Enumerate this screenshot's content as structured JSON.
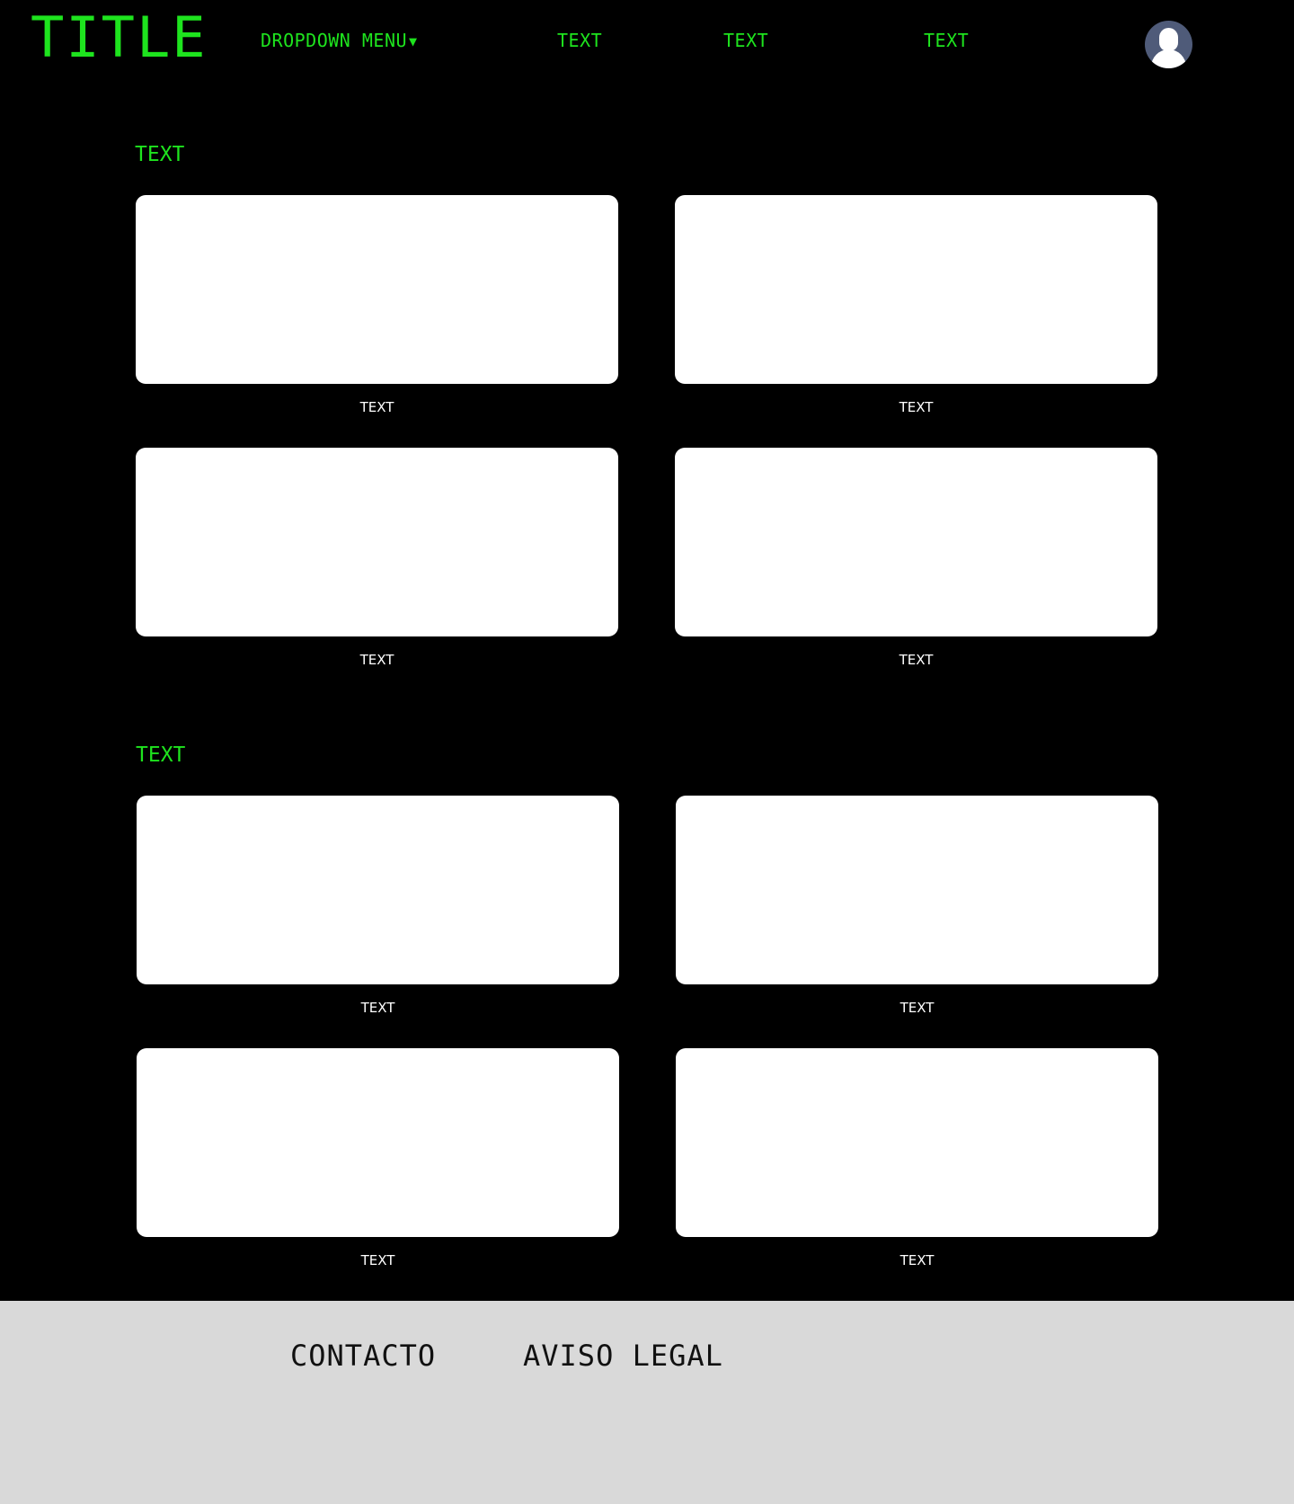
{
  "header": {
    "title": "TITLE",
    "nav": {
      "dropdown_label": "DROPDOWN MENU",
      "dropdown_caret": "▼",
      "items": [
        "TEXT",
        "TEXT",
        "TEXT"
      ]
    },
    "avatar_icon": "user-avatar-icon"
  },
  "sections": [
    {
      "title": "TEXT",
      "cards": [
        {
          "label": "TEXT"
        },
        {
          "label": "TEXT"
        },
        {
          "label": "TEXT"
        },
        {
          "label": "TEXT"
        }
      ]
    },
    {
      "title": "TEXT",
      "cards": [
        {
          "label": "TEXT"
        },
        {
          "label": "TEXT"
        },
        {
          "label": "TEXT"
        },
        {
          "label": "TEXT"
        }
      ]
    }
  ],
  "footer": {
    "contact_label": "CONTACTO",
    "legal_label": "AVISO LEGAL"
  },
  "colors": {
    "background": "#000000",
    "accent": "#1ee41e",
    "card": "#ffffff",
    "footer": "#d9d9d9",
    "avatar": "#4f5b79"
  }
}
